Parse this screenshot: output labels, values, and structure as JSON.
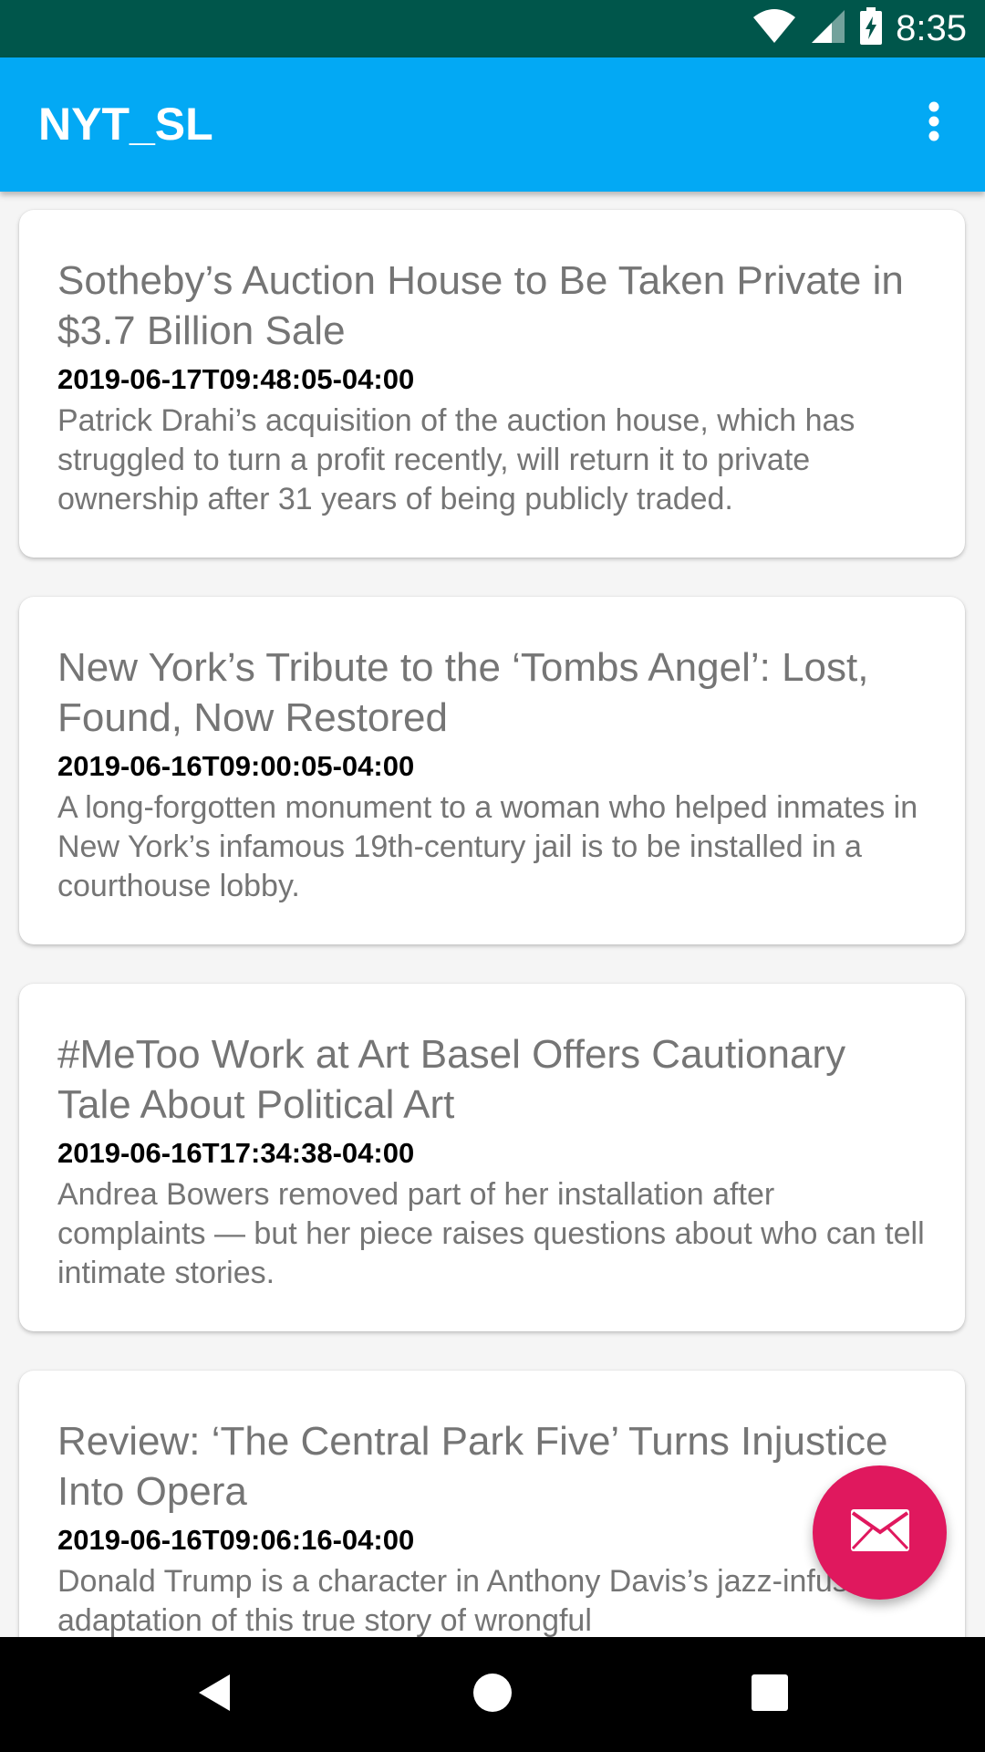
{
  "status_bar": {
    "time": "8:35",
    "icons": [
      "wifi-icon",
      "cell-signal-icon",
      "battery-charging-icon"
    ],
    "color": "#00564b"
  },
  "app_bar": {
    "title": "NYT_SL",
    "menu_icon": "more-vert-icon",
    "color": "#03a9f4"
  },
  "articles": [
    {
      "title": "Sotheby’s Auction House to Be Taken Private in $3.7 Billion Sale",
      "date": "2019-06-17T09:48:05-04:00",
      "snippet": "Patrick Drahi’s acquisition of the auction house, which has struggled to turn a profit recently, will return it to private ownership after 31 years of being publicly traded."
    },
    {
      "title": "New York’s Tribute to the ‘Tombs Angel’: Lost, Found, Now Restored",
      "date": "2019-06-16T09:00:05-04:00",
      "snippet": "A long-forgotten monument to a woman who helped inmates in New York’s infamous 19th-century jail is to be installed in a courthouse lobby."
    },
    {
      "title": "#MeToo Work at Art Basel Offers Cautionary Tale About Political Art",
      "date": "2019-06-16T17:34:38-04:00",
      "snippet": "Andrea Bowers removed part of her installation after complaints — but her piece raises questions about who can tell intimate stories."
    },
    {
      "title": "Review: ‘The Central Park Five’ Turns Injustice Into Opera",
      "date": "2019-06-16T09:06:16-04:00",
      "snippet": "Donald Trump is a character in Anthony Davis’s jazz-infused adaptation of this true story of wrongful"
    }
  ],
  "fab": {
    "icon": "mail-icon",
    "color": "#e0185e"
  },
  "nav_bar": {
    "icons": [
      "back-icon",
      "home-icon",
      "recents-icon"
    ]
  }
}
